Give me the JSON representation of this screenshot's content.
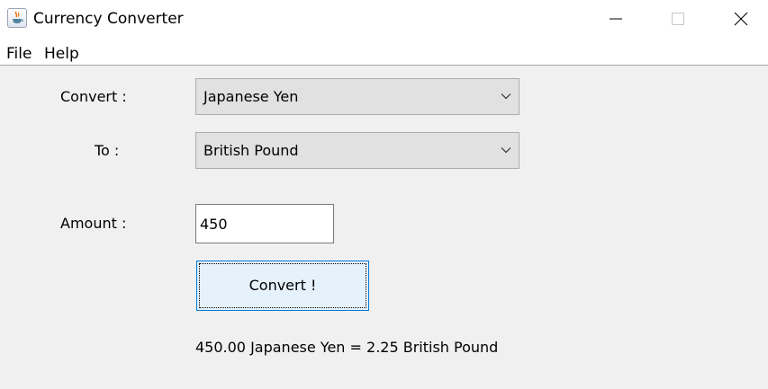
{
  "window": {
    "title": "Currency Converter",
    "icon": "java-cup-icon"
  },
  "menu": {
    "items": [
      {
        "label": "File"
      },
      {
        "label": "Help"
      }
    ]
  },
  "form": {
    "convert_label": "Convert :",
    "to_label": "To :",
    "amount_label": "Amount :",
    "from_currency": "Japanese Yen",
    "to_currency": "British Pound",
    "amount_value": "450",
    "convert_button": "Convert !"
  },
  "result": {
    "text": "450.00 Japanese Yen = 2.25 British Pound"
  },
  "colors": {
    "background": "#f0f0f0",
    "button_border": "#0078d7",
    "button_fill": "#e5f1fb"
  }
}
